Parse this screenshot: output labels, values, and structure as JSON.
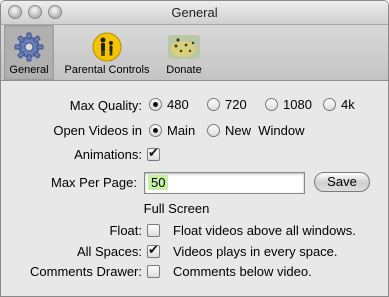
{
  "window": {
    "title": "General"
  },
  "toolbar": {
    "items": [
      {
        "label": "General",
        "icon": "gear-icon",
        "selected": true
      },
      {
        "label": "Parental Controls",
        "icon": "parental-controls-icon",
        "selected": false
      },
      {
        "label": "Donate",
        "icon": "donate-icon",
        "selected": false
      }
    ]
  },
  "settings": {
    "max_quality": {
      "label": "Max Quality:",
      "options": [
        "480",
        "720",
        "1080",
        "4k"
      ],
      "selected": "480"
    },
    "open_videos": {
      "label": "Open Videos in",
      "options": [
        "Main",
        "New  Window"
      ],
      "selected": "Main"
    },
    "animations": {
      "label": "Animations:",
      "checked": true
    },
    "max_per_page": {
      "label": "Max Per Page:",
      "value": "50",
      "save_label": "Save"
    },
    "full_screen": {
      "heading": "Full Screen",
      "float": {
        "label": "Float:",
        "description": "Float videos above all windows.",
        "checked": false
      },
      "all_spaces": {
        "label": "All Spaces:",
        "description": "Videos plays in every space.",
        "checked": true
      },
      "comments_drawer": {
        "label": "Comments Drawer:",
        "description": "Comments below video.",
        "checked": false
      }
    }
  },
  "colors": {
    "selection_highlight": "#c6f0a6",
    "gear_blue": "#6a7fb8",
    "parental_yellow": "#f5c400"
  }
}
